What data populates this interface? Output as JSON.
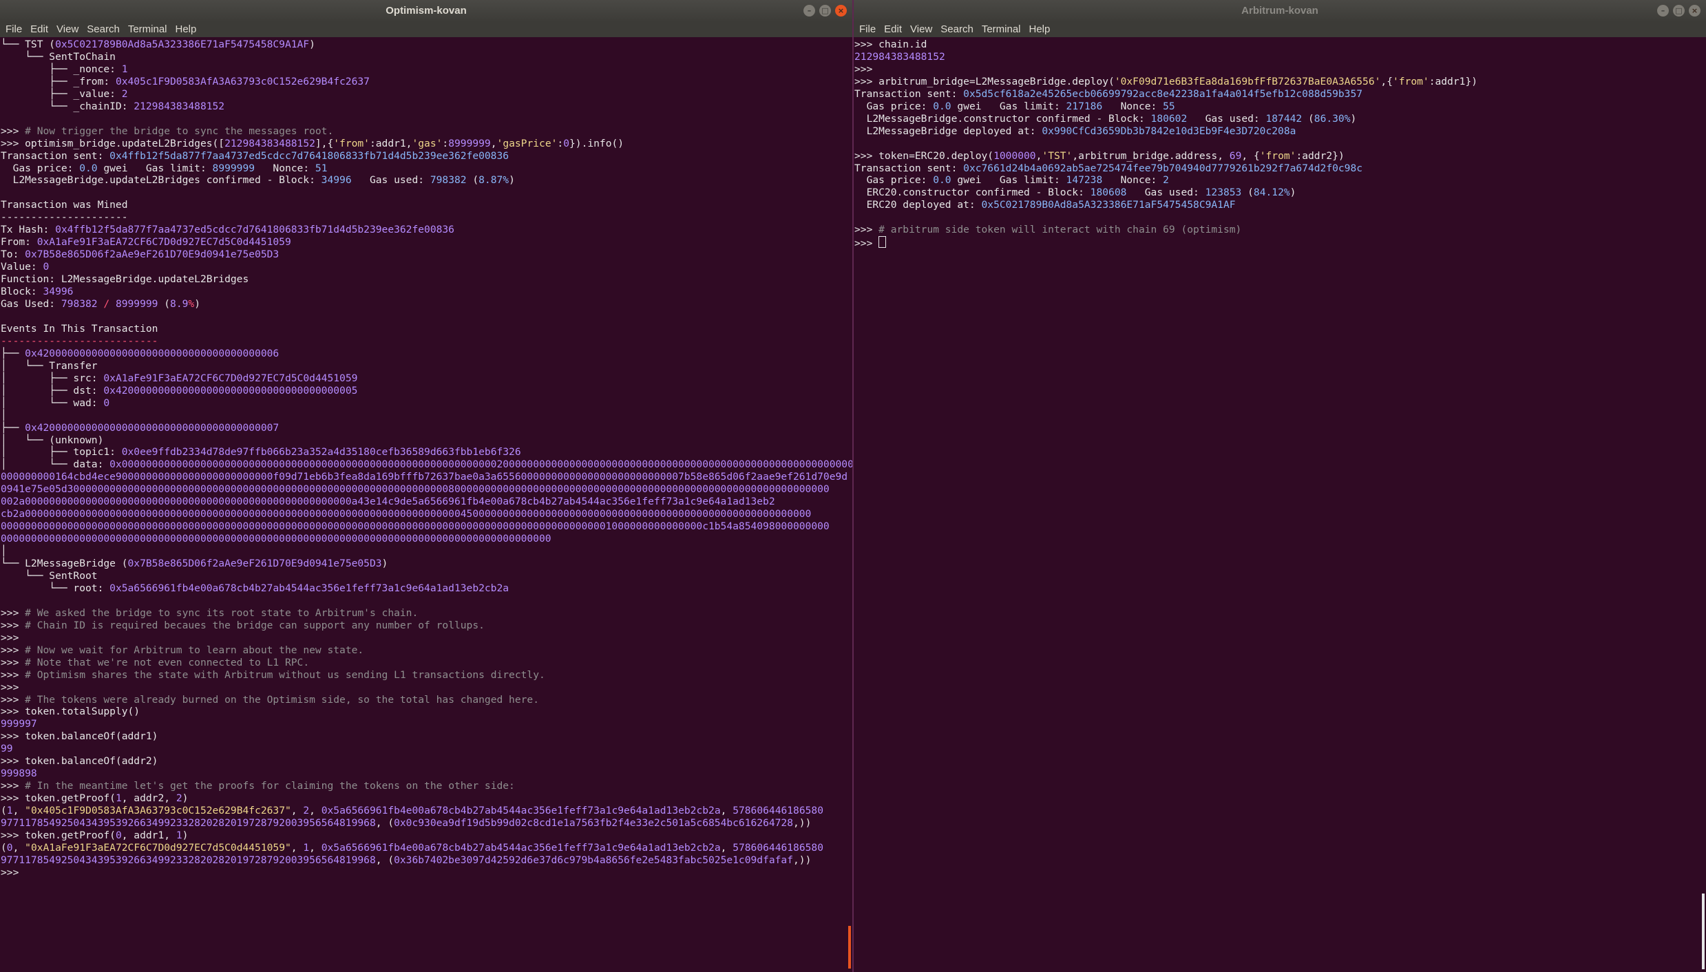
{
  "windows": {
    "left": {
      "title": "Optimism-kovan"
    },
    "right": {
      "title": "Arbitrum-kovan"
    }
  },
  "menu": [
    "File",
    "Edit",
    "View",
    "Search",
    "Terminal",
    "Help"
  ],
  "colors": {
    "background": "#300a24",
    "titlebar": "#3c3b37",
    "close_button": "#e95420",
    "text": "#e6e6e6",
    "address": "#b58cff",
    "hash": "#88b6f8",
    "comment": "#8f8f8f",
    "string": "#eed68a"
  },
  "left_terminal": [
    [
      {
        "t": "└── TST ("
      },
      {
        "t": "0x5C021789B0Ad8a5A323386E71aF5475458C9A1AF",
        "c": "purple"
      },
      {
        "t": ")"
      }
    ],
    [
      {
        "t": "    └── SentToChain"
      }
    ],
    [
      {
        "t": "        ├── _nonce: "
      },
      {
        "t": "1",
        "c": "purple"
      }
    ],
    [
      {
        "t": "        ├── _from: "
      },
      {
        "t": "0x405c1F9D0583AfA3A63793c0C152e629B4fc2637",
        "c": "purple"
      }
    ],
    [
      {
        "t": "        ├── _value: "
      },
      {
        "t": "2",
        "c": "purple"
      }
    ],
    [
      {
        "t": "        └── _chainID: "
      },
      {
        "t": "212984383488152",
        "c": "purple"
      }
    ],
    [
      {
        "t": ""
      }
    ],
    [
      {
        "t": ">>> "
      },
      {
        "t": "# Now trigger the bridge to sync the messages root.",
        "c": "comment"
      }
    ],
    [
      {
        "t": ">>> optimism_bridge.updateL2Bridges(["
      },
      {
        "t": "212984383488152",
        "c": "purple"
      },
      {
        "t": "],{"
      },
      {
        "t": "'from'",
        "c": "str"
      },
      {
        "t": ":addr1,"
      },
      {
        "t": "'gas'",
        "c": "str"
      },
      {
        "t": ":"
      },
      {
        "t": "8999999",
        "c": "purple"
      },
      {
        "t": ","
      },
      {
        "t": "'gasPrice'",
        "c": "str"
      },
      {
        "t": ":"
      },
      {
        "t": "0",
        "c": "purple"
      },
      {
        "t": "}).info()"
      }
    ],
    [
      {
        "t": "Transaction sent: "
      },
      {
        "t": "0x4ffb12f5da877f7aa4737ed5cdcc7d7641806833fb71d4d5b239ee362fe00836",
        "c": "blue"
      }
    ],
    [
      {
        "t": "  Gas price: "
      },
      {
        "t": "0.0",
        "c": "blue"
      },
      {
        "t": " gwei   Gas limit: "
      },
      {
        "t": "8999999",
        "c": "blue"
      },
      {
        "t": "   Nonce: "
      },
      {
        "t": "51",
        "c": "blue"
      }
    ],
    [
      {
        "t": "  L2MessageBridge.updateL2Bridges confirmed - Block: "
      },
      {
        "t": "34996",
        "c": "blue"
      },
      {
        "t": "   Gas used: "
      },
      {
        "t": "798382",
        "c": "blue"
      },
      {
        "t": " ("
      },
      {
        "t": "8.87%",
        "c": "blue"
      },
      {
        "t": ")"
      }
    ],
    [
      {
        "t": ""
      }
    ],
    [
      {
        "t": "Transaction was Mined"
      }
    ],
    [
      {
        "t": "---------------------"
      }
    ],
    [
      {
        "t": "Tx Hash: "
      },
      {
        "t": "0x4ffb12f5da877f7aa4737ed5cdcc7d7641806833fb71d4d5b239ee362fe00836",
        "c": "purple"
      }
    ],
    [
      {
        "t": "From: "
      },
      {
        "t": "0xA1aFe91F3aEA72CF6C7D0d927EC7d5C0d4451059",
        "c": "purple"
      }
    ],
    [
      {
        "t": "To: "
      },
      {
        "t": "0x7B58e865D06f2aAe9eF261D70E9d0941e75e05D3",
        "c": "purple"
      }
    ],
    [
      {
        "t": "Value: "
      },
      {
        "t": "0",
        "c": "purple"
      }
    ],
    [
      {
        "t": "Function: L2MessageBridge.updateL2Bridges"
      }
    ],
    [
      {
        "t": "Block: "
      },
      {
        "t": "34996",
        "c": "purple"
      }
    ],
    [
      {
        "t": "Gas Used: "
      },
      {
        "t": "798382",
        "c": "purple"
      },
      {
        "t": " / ",
        "c": "red"
      },
      {
        "t": "8999999",
        "c": "purple"
      },
      {
        "t": " ("
      },
      {
        "t": "8.9",
        "c": "purple"
      },
      {
        "t": "%",
        "c": "red"
      },
      {
        "t": ")"
      }
    ],
    [
      {
        "t": ""
      }
    ],
    [
      {
        "t": "Events In This Transaction"
      }
    ],
    [
      {
        "t": "--------------------------",
        "c": "red"
      }
    ],
    [
      {
        "t": "├── "
      },
      {
        "t": "0x4200000000000000000000000000000000000006",
        "c": "purple"
      }
    ],
    [
      {
        "t": "│   └── Transfer"
      }
    ],
    [
      {
        "t": "│       ├── src: "
      },
      {
        "t": "0xA1aFe91F3aEA72CF6C7D0d927EC7d5C0d4451059",
        "c": "purple"
      }
    ],
    [
      {
        "t": "│       ├── dst: "
      },
      {
        "t": "0x4200000000000000000000000000000000000005",
        "c": "purple"
      }
    ],
    [
      {
        "t": "│       └── wad: "
      },
      {
        "t": "0",
        "c": "purple"
      }
    ],
    [
      {
        "t": "│"
      }
    ],
    [
      {
        "t": "├── "
      },
      {
        "t": "0x4200000000000000000000000000000000000007",
        "c": "purple"
      }
    ],
    [
      {
        "t": "│   └── (unknown)"
      }
    ],
    [
      {
        "t": "│       ├── topic1: "
      },
      {
        "t": "0x0ee9ffdb2334d78de97ffb066b23a352a4d35180cefb36589d663fbb1eb6f326",
        "c": "purple"
      }
    ],
    [
      {
        "t": "│       └── data: "
      },
      {
        "t": "0x00000000000000000000000000000000000000000000000000000000000000200000000000000000000000000000000000000000000000000000000000000000",
        "c": "purple"
      }
    ],
    [
      {
        "t": "000000000164cbd4ece90000000000000000000000000f09d71eb6b3fea8da169bfffb72637bae0a3a6556000000000000000000000000007b58e865d06f2aae9ef261d70e9d",
        "c": "purple"
      }
    ],
    [
      {
        "t": "0941e75e05d300000000000000000000000000000000000000000000000000000000000000800000000000000000000000000000000000000000000000000000000000000",
        "c": "purple"
      }
    ],
    [
      {
        "t": "002a000000000000000000000000000000000000000000000000000000a43e14c9de5a6566961fb4e00a678cb4b27ab4544ac356e1feff73a1c9e64a1ad13eb2",
        "c": "purple"
      }
    ],
    [
      {
        "t": "cb2a0000000000000000000000000000000000000000000000000000000000000000000000004500000000000000000000000000000000000000000000000000000000",
        "c": "purple"
      }
    ],
    [
      {
        "t": "00000000000000000000000000000000000000000000000000000000000000000000000000000000000000000000000000001000000000000000c1b54a854098000000000",
        "c": "purple"
      }
    ],
    [
      {
        "t": "0000000000000000000000000000000000000000000000000000000000000000000000000000000000000000000",
        "c": "purple"
      }
    ],
    [
      {
        "t": "│"
      }
    ],
    [
      {
        "t": "└── L2MessageBridge ("
      },
      {
        "t": "0x7B58e865D06f2aAe9eF261D70E9d0941e75e05D3",
        "c": "purple"
      },
      {
        "t": ")"
      }
    ],
    [
      {
        "t": "    └── SentRoot"
      }
    ],
    [
      {
        "t": "        └── root: "
      },
      {
        "t": "0x5a6566961fb4e00a678cb4b27ab4544ac356e1feff73a1c9e64a1ad13eb2cb2a",
        "c": "purple"
      }
    ],
    [
      {
        "t": ""
      }
    ],
    [
      {
        "t": ">>> "
      },
      {
        "t": "# We asked the bridge to sync its root state to Arbitrum's chain.",
        "c": "comment"
      }
    ],
    [
      {
        "t": ">>> "
      },
      {
        "t": "# Chain ID is required becaues the bridge can support any number of rollups.",
        "c": "comment"
      }
    ],
    [
      {
        "t": ">>>"
      }
    ],
    [
      {
        "t": ">>> "
      },
      {
        "t": "# Now we wait for Arbitrum to learn about the new state.",
        "c": "comment"
      }
    ],
    [
      {
        "t": ">>> "
      },
      {
        "t": "# Note that we're not even connected to L1 RPC.",
        "c": "comment"
      }
    ],
    [
      {
        "t": ">>> "
      },
      {
        "t": "# Optimism shares the state with Arbitrum without us sending L1 transactions directly.",
        "c": "comment"
      }
    ],
    [
      {
        "t": ">>>"
      }
    ],
    [
      {
        "t": ">>> "
      },
      {
        "t": "# The tokens were already burned on the Optimism side, so the total has changed here.",
        "c": "comment"
      }
    ],
    [
      {
        "t": ">>> token.totalSupply()"
      }
    ],
    [
      {
        "t": "999997",
        "c": "purple"
      }
    ],
    [
      {
        "t": ">>> token.balanceOf(addr1)"
      }
    ],
    [
      {
        "t": "99",
        "c": "purple"
      }
    ],
    [
      {
        "t": ">>> token.balanceOf(addr2)"
      }
    ],
    [
      {
        "t": "999898",
        "c": "purple"
      }
    ],
    [
      {
        "t": ">>> "
      },
      {
        "t": "# In the meantime let's get the proofs for claiming the tokens on the other side:",
        "c": "comment"
      }
    ],
    [
      {
        "t": ">>> token.getProof("
      },
      {
        "t": "1",
        "c": "purple"
      },
      {
        "t": ", addr2, "
      },
      {
        "t": "2",
        "c": "purple"
      },
      {
        "t": ")"
      }
    ],
    [
      {
        "t": "("
      },
      {
        "t": "1",
        "c": "purple"
      },
      {
        "t": ", "
      },
      {
        "t": "\"0x405c1F9D0583AfA3A63793c0C152e629B4fc2637\"",
        "c": "str"
      },
      {
        "t": ", "
      },
      {
        "t": "2",
        "c": "purple"
      },
      {
        "t": ", "
      },
      {
        "t": "0x5a6566961fb4e00a678cb4b27ab4544ac356e1feff73a1c9e64a1ad13eb2cb2a",
        "c": "purple"
      },
      {
        "t": ", "
      },
      {
        "t": "578606446186580",
        "c": "purple"
      }
    ],
    [
      {
        "t": "97711785492504343953926634992332820282019728792003956564819968",
        "c": "purple"
      },
      {
        "t": ", ("
      },
      {
        "t": "0x0c930ea9df19d5b99d02c8cd1e1a7563fb2f4e33e2c501a5c6854bc616264728",
        "c": "purple"
      },
      {
        "t": ",))"
      }
    ],
    [
      {
        "t": ">>> token.getProof("
      },
      {
        "t": "0",
        "c": "purple"
      },
      {
        "t": ", addr1, "
      },
      {
        "t": "1",
        "c": "purple"
      },
      {
        "t": ")"
      }
    ],
    [
      {
        "t": "("
      },
      {
        "t": "0",
        "c": "purple"
      },
      {
        "t": ", "
      },
      {
        "t": "\"0xA1aFe91F3aEA72CF6C7D0d927EC7d5C0d4451059\"",
        "c": "str"
      },
      {
        "t": ", "
      },
      {
        "t": "1",
        "c": "purple"
      },
      {
        "t": ", "
      },
      {
        "t": "0x5a6566961fb4e00a678cb4b27ab4544ac356e1feff73a1c9e64a1ad13eb2cb2a",
        "c": "purple"
      },
      {
        "t": ", "
      },
      {
        "t": "578606446186580",
        "c": "purple"
      }
    ],
    [
      {
        "t": "97711785492504343953926634992332820282019728792003956564819968",
        "c": "purple"
      },
      {
        "t": ", ("
      },
      {
        "t": "0x36b7402be3097d42592d6e37d6c979b4a8656fe2e5483fabc5025e1c09dfafaf",
        "c": "purple"
      },
      {
        "t": ",))"
      }
    ],
    [
      {
        "t": ">>>"
      }
    ]
  ],
  "right_terminal": [
    [
      {
        "t": ">>> chain.id"
      }
    ],
    [
      {
        "t": "212984383488152",
        "c": "purple"
      }
    ],
    [
      {
        "t": ">>>"
      }
    ],
    [
      {
        "t": ">>> arbitrum_bridge=L2MessageBridge.deploy("
      },
      {
        "t": "'0xF09d71e6B3fEa8da169bfFfB72637BaE0A3A6556'",
        "c": "str"
      },
      {
        "t": ",{"
      },
      {
        "t": "'from'",
        "c": "str"
      },
      {
        "t": ":addr1})"
      }
    ],
    [
      {
        "t": "Transaction sent: "
      },
      {
        "t": "0x5d5cf618a2e45265ecb06699792acc8e42238a1fa4a014f5efb12c088d59b357",
        "c": "blue"
      }
    ],
    [
      {
        "t": "  Gas price: "
      },
      {
        "t": "0.0",
        "c": "blue"
      },
      {
        "t": " gwei   Gas limit: "
      },
      {
        "t": "217186",
        "c": "blue"
      },
      {
        "t": "   Nonce: "
      },
      {
        "t": "55",
        "c": "blue"
      }
    ],
    [
      {
        "t": "  L2MessageBridge.constructor confirmed - Block: "
      },
      {
        "t": "180602",
        "c": "blue"
      },
      {
        "t": "   Gas used: "
      },
      {
        "t": "187442",
        "c": "blue"
      },
      {
        "t": " ("
      },
      {
        "t": "86.30%",
        "c": "blue"
      },
      {
        "t": ")"
      }
    ],
    [
      {
        "t": "  L2MessageBridge deployed at: "
      },
      {
        "t": "0x990CfCd3659Db3b7842e10d3Eb9F4e3D720c208a",
        "c": "blue"
      }
    ],
    [
      {
        "t": ""
      }
    ],
    [
      {
        "t": ">>> token=ERC20.deploy("
      },
      {
        "t": "1000000",
        "c": "purple"
      },
      {
        "t": ","
      },
      {
        "t": "'TST'",
        "c": "str"
      },
      {
        "t": ",arbitrum_bridge.address, "
      },
      {
        "t": "69",
        "c": "purple"
      },
      {
        "t": ", {"
      },
      {
        "t": "'from'",
        "c": "str"
      },
      {
        "t": ":addr2})"
      }
    ],
    [
      {
        "t": "Transaction sent: "
      },
      {
        "t": "0xc7661d24b4a0692ab5ae725474fee79b704940d7779261b292f7a674d2f0c98c",
        "c": "blue"
      }
    ],
    [
      {
        "t": "  Gas price: "
      },
      {
        "t": "0.0",
        "c": "blue"
      },
      {
        "t": " gwei   Gas limit: "
      },
      {
        "t": "147238",
        "c": "blue"
      },
      {
        "t": "   Nonce: "
      },
      {
        "t": "2",
        "c": "blue"
      }
    ],
    [
      {
        "t": "  ERC20.constructor confirmed - Block: "
      },
      {
        "t": "180608",
        "c": "blue"
      },
      {
        "t": "   Gas used: "
      },
      {
        "t": "123853",
        "c": "blue"
      },
      {
        "t": " ("
      },
      {
        "t": "84.12%",
        "c": "blue"
      },
      {
        "t": ")"
      }
    ],
    [
      {
        "t": "  ERC20 deployed at: "
      },
      {
        "t": "0x5C021789B0Ad8a5A323386E71aF5475458C9A1AF",
        "c": "blue"
      }
    ],
    [
      {
        "t": ""
      }
    ],
    [
      {
        "t": ">>> "
      },
      {
        "t": "# arbitrum side token will interact with chain 69 (optimism)",
        "c": "comment"
      }
    ],
    [
      {
        "t": ">>> "
      },
      {
        "t": "",
        "cursor": true
      }
    ]
  ]
}
